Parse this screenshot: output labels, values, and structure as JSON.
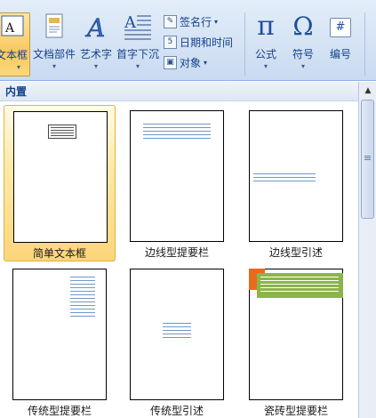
{
  "ribbon": {
    "buttons": [
      {
        "label": "文本框",
        "icon": "text-box-icon"
      },
      {
        "label": "文档部件",
        "icon": "quick-parts-icon"
      },
      {
        "label": "艺术字",
        "icon": "wordart-icon"
      },
      {
        "label": "首字下沉",
        "icon": "drop-cap-icon"
      }
    ],
    "small_buttons": [
      {
        "label": "签名行",
        "icon": "signature-line-icon"
      },
      {
        "label": "日期和时间",
        "icon": "date-time-icon"
      },
      {
        "label": "对象",
        "icon": "object-icon"
      }
    ],
    "symbols": [
      {
        "label": "公式",
        "glyph": "π",
        "icon": "equation-icon"
      },
      {
        "label": "符号",
        "glyph": "Ω",
        "icon": "symbol-icon"
      },
      {
        "label": "编号",
        "glyph": "#",
        "icon": "number-icon"
      }
    ]
  },
  "gallery": {
    "section": "内置",
    "items": [
      {
        "label": "简单文本框",
        "selected": true
      },
      {
        "label": "边线型提要栏",
        "selected": false
      },
      {
        "label": "边线型引述",
        "selected": false
      },
      {
        "label": "传统型提要栏",
        "selected": false
      },
      {
        "label": "传统型引述",
        "selected": false
      },
      {
        "label": "瓷砖型提要栏",
        "selected": false
      }
    ]
  },
  "colors": {
    "ribbon_text": "#15428b",
    "selection": "#fdd57a",
    "accent_orange": "#e86a1c",
    "accent_green": "#8cb44a"
  }
}
